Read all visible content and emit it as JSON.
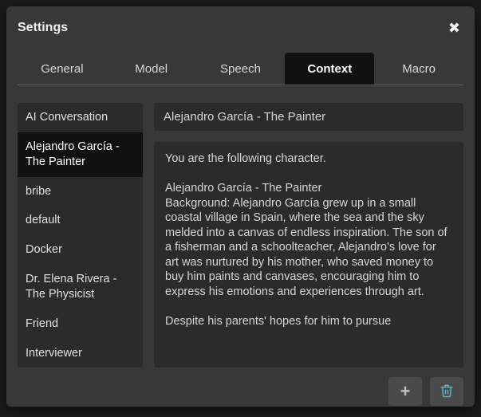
{
  "window": {
    "title": "Settings"
  },
  "tabs": [
    {
      "label": "General",
      "active": false
    },
    {
      "label": "Model",
      "active": false
    },
    {
      "label": "Speech",
      "active": false
    },
    {
      "label": "Context",
      "active": true
    },
    {
      "label": "Macro",
      "active": false
    }
  ],
  "contexts": {
    "items": [
      {
        "label": "AI Conversation",
        "selected": false
      },
      {
        "label": "Alejandro García - The Painter",
        "selected": true
      },
      {
        "label": "bribe",
        "selected": false
      },
      {
        "label": "default",
        "selected": false
      },
      {
        "label": "Docker",
        "selected": false
      },
      {
        "label": "Dr. Elena Rivera - The Physicist",
        "selected": false
      },
      {
        "label": "Friend",
        "selected": false
      },
      {
        "label": "Interviewer",
        "selected": false
      }
    ]
  },
  "editor": {
    "name_value": "Alejandro García - The Painter",
    "body_value": "You are the following character.\n\nAlejandro García - The Painter\nBackground: Alejandro García grew up in a small coastal village in Spain, where the sea and the sky melded into a canvas of endless inspiration. The son of a fisherman and a schoolteacher, Alejandro's love for art was nurtured by his mother, who saved money to buy him paints and canvases, encouraging him to express his emotions and experiences through art.\n\nDespite his parents' hopes for him to pursue"
  },
  "icons": {
    "close": "✖",
    "plus": "+",
    "trash": "trash-icon"
  },
  "colors": {
    "modal_bg": "#383838",
    "panel_bg": "#2b2b2b",
    "active_bg": "#111111",
    "text": "#e6e6e6",
    "trash_accent": "#5ab3cc"
  }
}
